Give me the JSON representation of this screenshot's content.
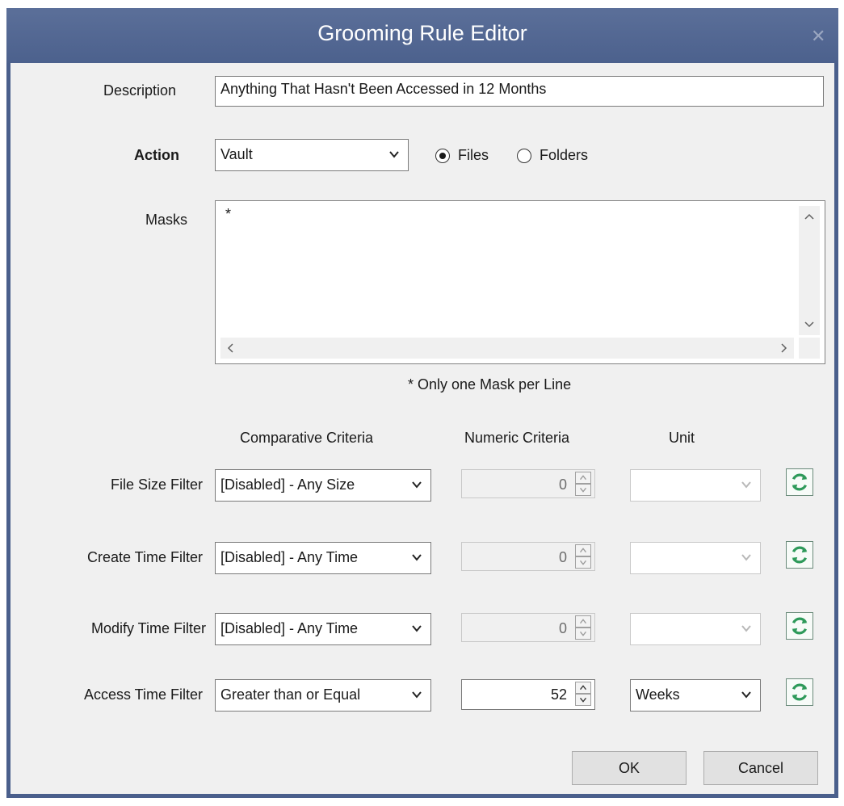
{
  "window": {
    "title": "Grooming Rule Editor",
    "close_icon": "close-icon"
  },
  "description": {
    "label": "Description",
    "value": "Anything That Hasn't Been Accessed in 12 Months"
  },
  "action": {
    "label": "Action",
    "selected": "Vault",
    "radio_files": "Files",
    "radio_folders": "Folders",
    "selected_radio": "Files"
  },
  "masks": {
    "label": "Masks",
    "content": "*",
    "note": "* Only one Mask per Line"
  },
  "columns": {
    "comparative": "Comparative Criteria",
    "numeric": "Numeric Criteria",
    "unit": "Unit"
  },
  "filters": [
    {
      "label": "File Size Filter",
      "comparative": "[Disabled] - Any Size",
      "numeric": "0",
      "unit": "",
      "enabled": false
    },
    {
      "label": "Create Time Filter",
      "comparative": "[Disabled] - Any Time",
      "numeric": "0",
      "unit": "",
      "enabled": false
    },
    {
      "label": "Modify Time Filter",
      "comparative": "[Disabled] - Any Time",
      "numeric": "0",
      "unit": "",
      "enabled": false
    },
    {
      "label": "Access Time Filter",
      "comparative": "Greater than or Equal",
      "numeric": "52",
      "unit": "Weeks",
      "enabled": true
    }
  ],
  "buttons": {
    "ok": "OK",
    "cancel": "Cancel"
  },
  "colors": {
    "titlebar": "#4c618d",
    "client": "#f0f0f0",
    "refresh_green": "#2e9a5a"
  }
}
